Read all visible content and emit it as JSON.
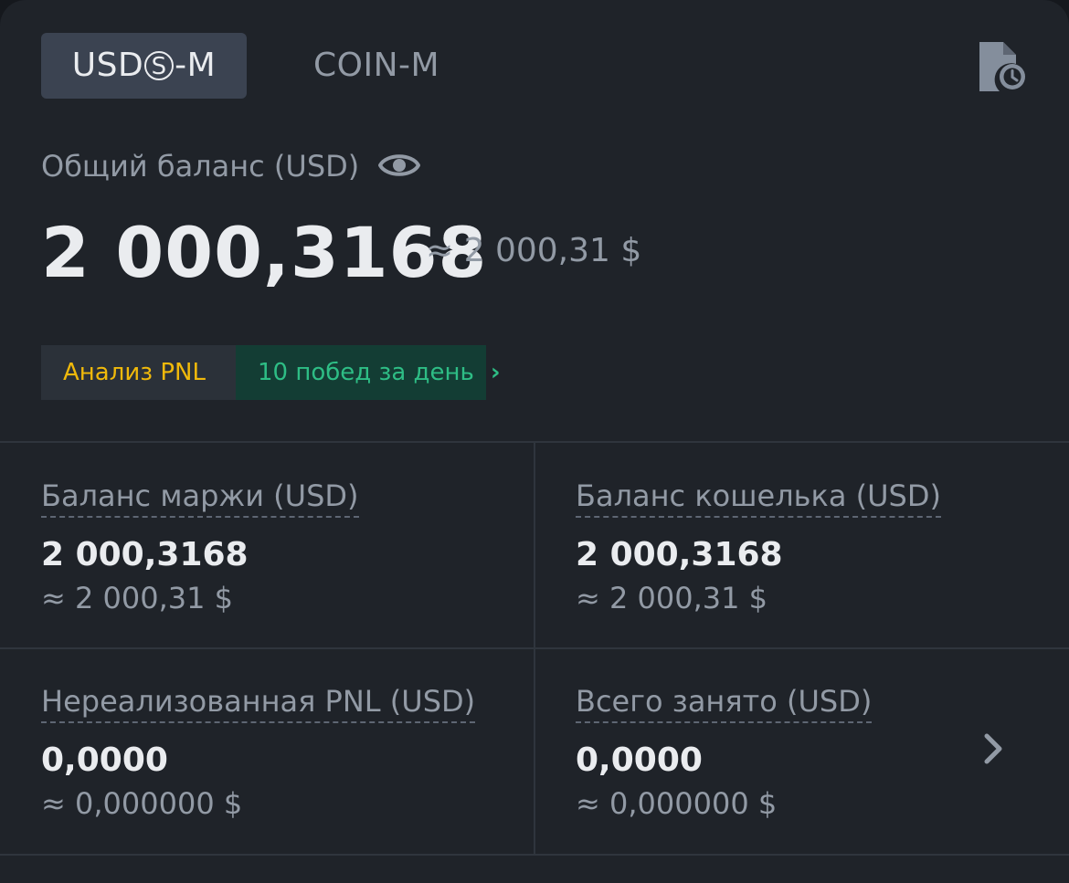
{
  "tabs": {
    "usds_prefix": "USD",
    "usds_circled": "S",
    "usds_suffix": "-M",
    "coin": "COIN-M"
  },
  "icons": {
    "history": "document-clock-icon",
    "visibility": "eye-icon",
    "chevron": "chevron-right-icon"
  },
  "balance": {
    "label": "Общий баланс (USD)",
    "value": "2 000,3168",
    "approx": "≈ 2 000,31 $"
  },
  "pnl": {
    "analysis_label": "Анализ PNL",
    "wins_label": "10 побед за день"
  },
  "stats": [
    {
      "label": "Баланс маржи (USD)",
      "value": "2 000,3168",
      "approx": "≈ 2 000,31 $"
    },
    {
      "label": "Баланс кошелька (USD)",
      "value": "2 000,3168",
      "approx": "≈ 2 000,31 $"
    },
    {
      "label": "Нереализованная PNL (USD)",
      "value": "0,0000",
      "approx": "≈ 0,000000 $"
    },
    {
      "label": "Всего занято (USD)",
      "value": "0,0000",
      "approx": "≈ 0,000000 $"
    }
  ],
  "colors": {
    "background": "#1f2329",
    "accent_yellow": "#f0b90b",
    "accent_green": "#2ebd85",
    "muted_text": "#929aa5",
    "primary_text": "#eaecef"
  }
}
